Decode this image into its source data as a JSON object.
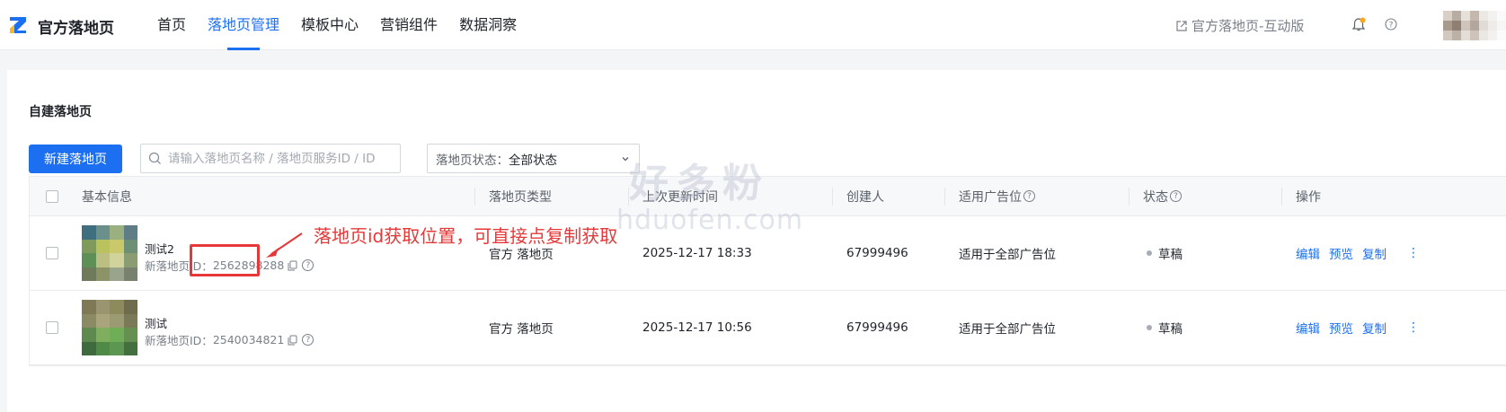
{
  "header": {
    "brand": "官方落地页",
    "nav": [
      "首页",
      "落地页管理",
      "模板中心",
      "营销组件",
      "数据洞察"
    ],
    "active_nav": 1,
    "ext_link": "官方落地页-互动版"
  },
  "page": {
    "section_title": "自建落地页",
    "new_button": "新建落地页",
    "search_placeholder": "请输入落地页名称 / 落地页服务ID / ID",
    "status_filter_label": "落地页状态：",
    "status_filter_value": "全部状态"
  },
  "table": {
    "columns": [
      "基本信息",
      "落地页类型",
      "上次更新时间",
      "创建人",
      "适用广告位",
      "状态",
      "操作"
    ],
    "rows": [
      {
        "name": "测试2",
        "id_label": "新落地页ID：",
        "id": "2562898288",
        "type": "官方 落地页",
        "updated": "2025-12-17 18:33",
        "creator": "67999496",
        "placement": "适用于全部广告位",
        "status": "草稿",
        "actions": [
          "编辑",
          "预览",
          "复制"
        ]
      },
      {
        "name": "测试",
        "id_label": "新落地页ID：",
        "id": "2540034821",
        "type": "官方 落地页",
        "updated": "2025-12-17 10:56",
        "creator": "67999496",
        "placement": "适用于全部广告位",
        "status": "草稿",
        "actions": [
          "编辑",
          "预览",
          "复制"
        ]
      }
    ]
  },
  "annotation": {
    "text": "落地页id获取位置，可直接点复制获取"
  },
  "watermark": {
    "line1": "好多粉",
    "line2": "hduofen.com"
  },
  "colors": {
    "primary": "#1d6ff2",
    "annotation": "#e63838",
    "draft_dot": "#a8adb5"
  }
}
